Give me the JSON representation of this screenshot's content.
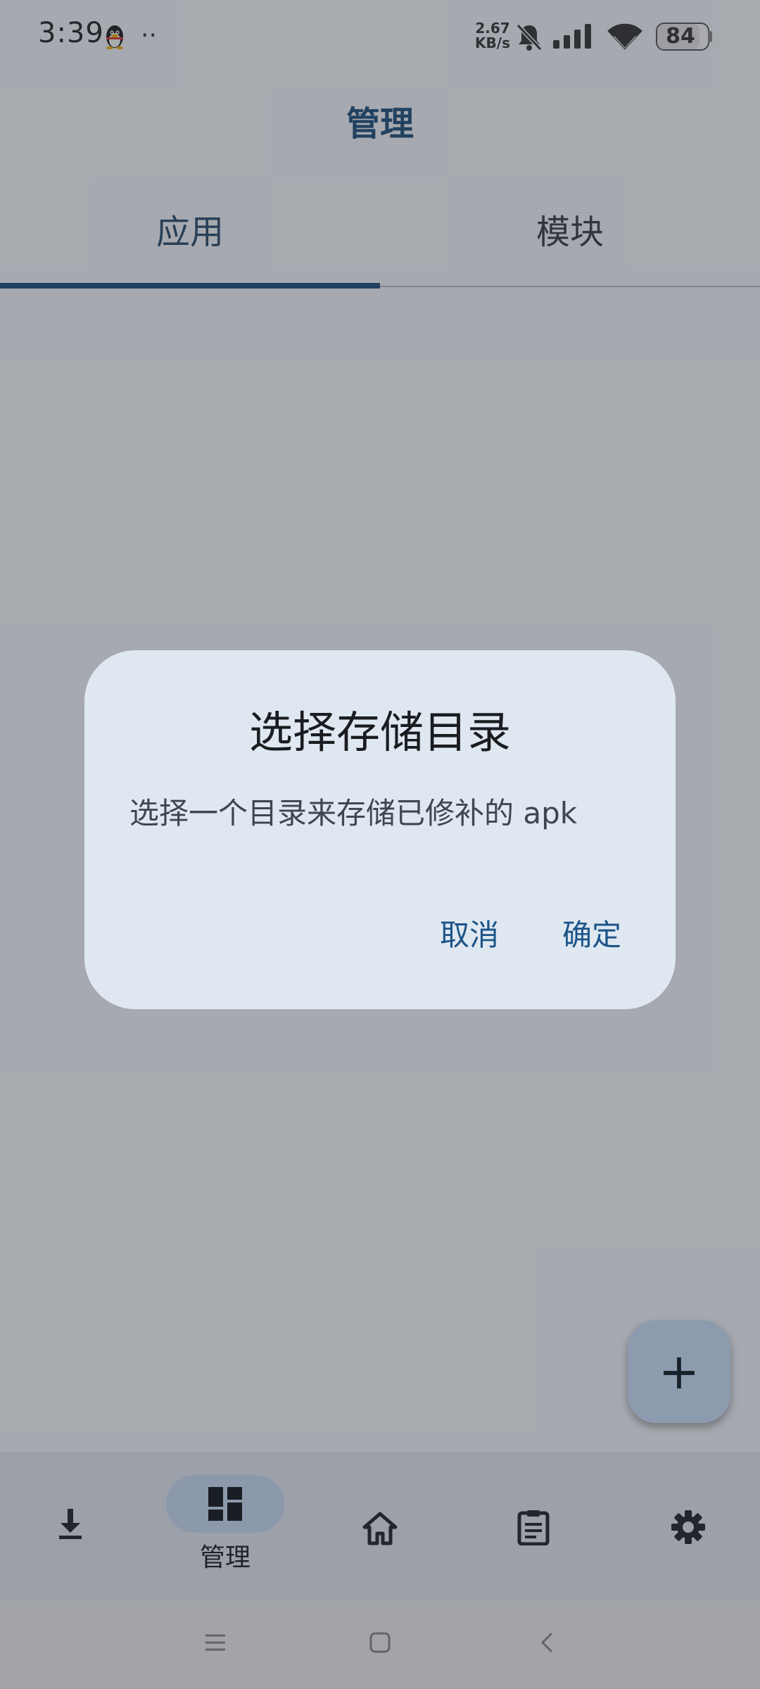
{
  "status_bar": {
    "time": "3:39",
    "dots": "··",
    "net_speed_value": "2.67",
    "net_speed_unit": "KB/s",
    "battery_percent": "84",
    "battery_level": 0.84
  },
  "header": {
    "title": "管理"
  },
  "tabs": [
    {
      "label": "应用",
      "selected": true
    },
    {
      "label": "模块",
      "selected": false
    }
  ],
  "fab": {
    "icon": "plus-icon",
    "label": "+"
  },
  "bottom_nav": [
    {
      "icon": "download-icon",
      "label": "",
      "selected": false
    },
    {
      "icon": "dashboard-icon",
      "label": "管理",
      "selected": true
    },
    {
      "icon": "home-icon",
      "label": "",
      "selected": false
    },
    {
      "icon": "clipboard-icon",
      "label": "",
      "selected": false
    },
    {
      "icon": "settings-icon",
      "label": "",
      "selected": false
    }
  ],
  "system_nav": [
    "menu-icon",
    "home-square-icon",
    "back-icon"
  ],
  "dialog": {
    "title": "选择存储目录",
    "message": "选择一个目录来存储已修补的 apk",
    "cancel_label": "取消",
    "confirm_label": "确定"
  },
  "colors": {
    "accent": "#1e4f7e",
    "dialog_bg": "#dfe8f1",
    "button_text": "#1c5488",
    "fab_bg": "#d0e4ff"
  }
}
